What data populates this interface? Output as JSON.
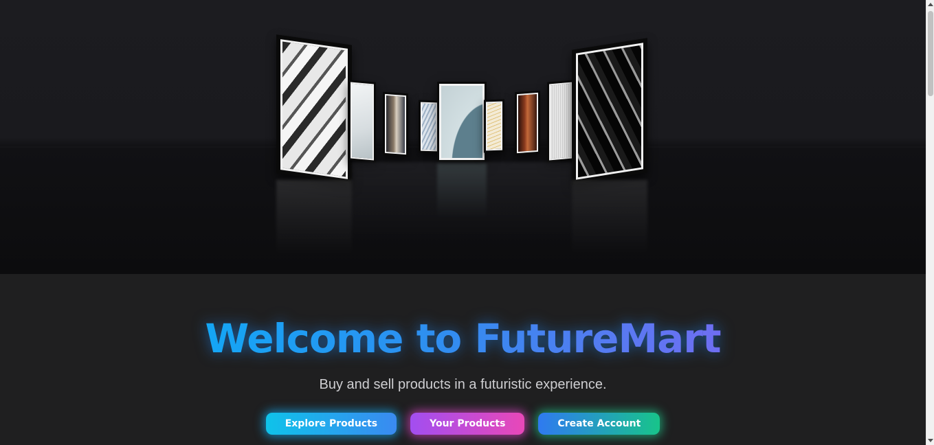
{
  "welcome": {
    "title": "Welcome to FutureMart",
    "subtitle": "Buy and sell products in a futuristic experience."
  },
  "buttons": {
    "explore": "Explore Products",
    "yours": "Your Products",
    "create": "Create Account"
  },
  "colors": {
    "background": "#1f1f20",
    "title_gradient_start": "#14a6f5",
    "title_gradient_end": "#6f6ef2",
    "explore_button": "#0fc2ea",
    "yours_button": "#c94cd8",
    "create_button": "#18c48a"
  }
}
